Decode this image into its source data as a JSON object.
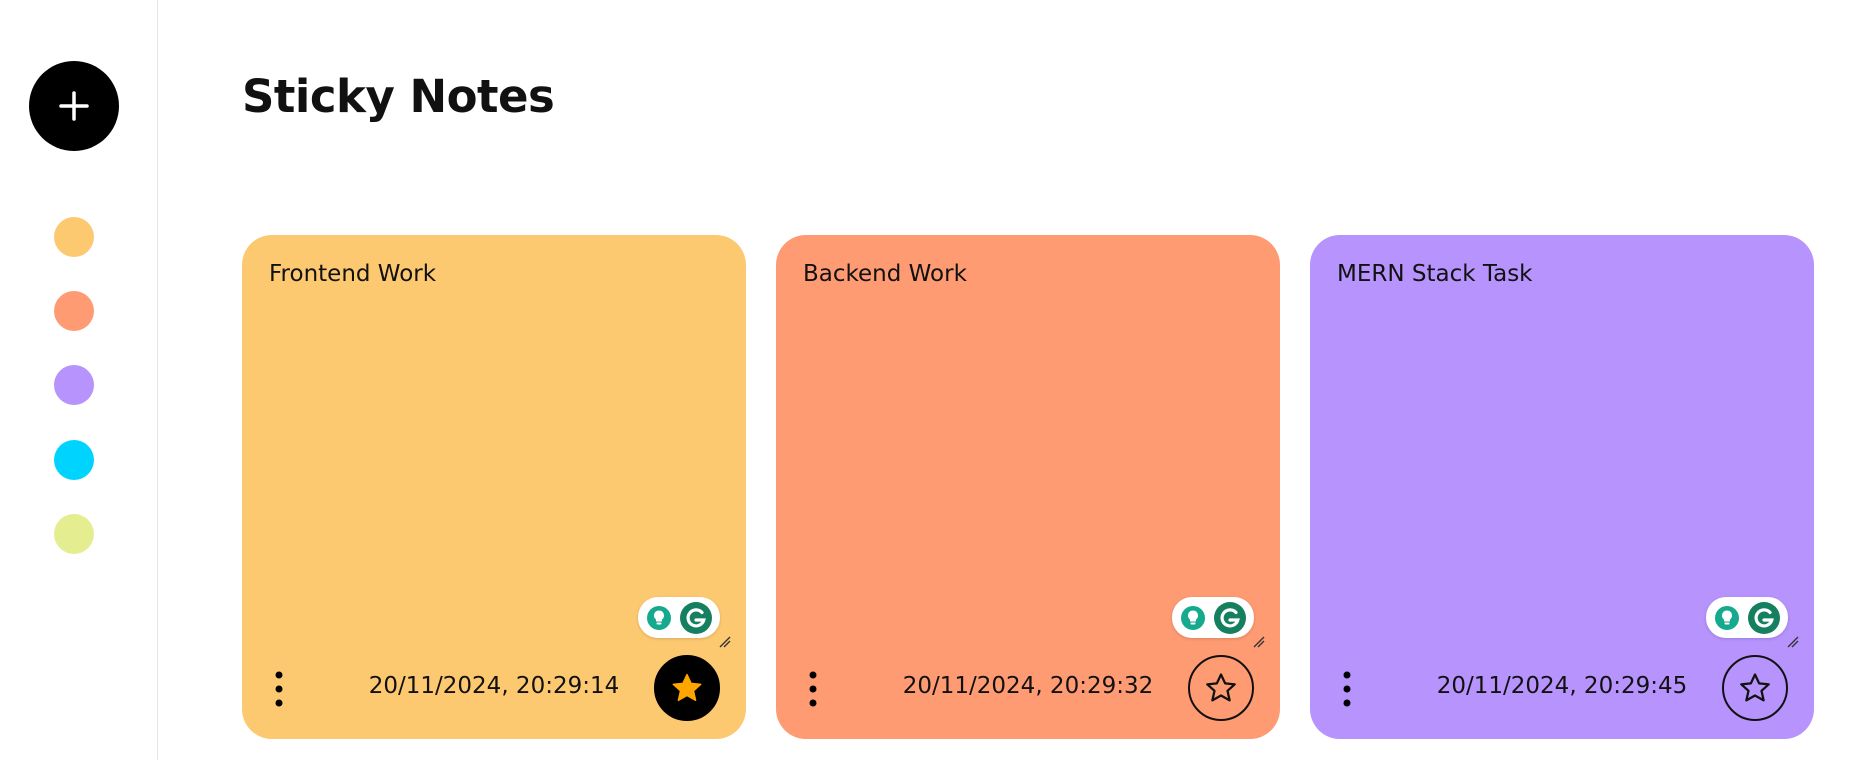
{
  "header": {
    "title": "Sticky Notes"
  },
  "sidebar": {
    "add_button_icon": "plus-icon",
    "colors": [
      {
        "name": "orange-yellow",
        "hex": "#FDC970"
      },
      {
        "name": "salmon",
        "hex": "#FE9B72"
      },
      {
        "name": "lavender",
        "hex": "#B693FD"
      },
      {
        "name": "cyan",
        "hex": "#00D4FE"
      },
      {
        "name": "lime",
        "hex": "#E4EE91"
      }
    ]
  },
  "notes": [
    {
      "text": "Frontend Work",
      "timestamp": "20/11/2024, 20:29:14",
      "color": "#FDC970",
      "favorite": true
    },
    {
      "text": "Backend Work",
      "timestamp": "20/11/2024, 20:29:32",
      "color": "#FE9B72",
      "favorite": false
    },
    {
      "text": "MERN Stack Task",
      "timestamp": "20/11/2024, 20:29:45",
      "color": "#B693FD",
      "favorite": false
    }
  ]
}
